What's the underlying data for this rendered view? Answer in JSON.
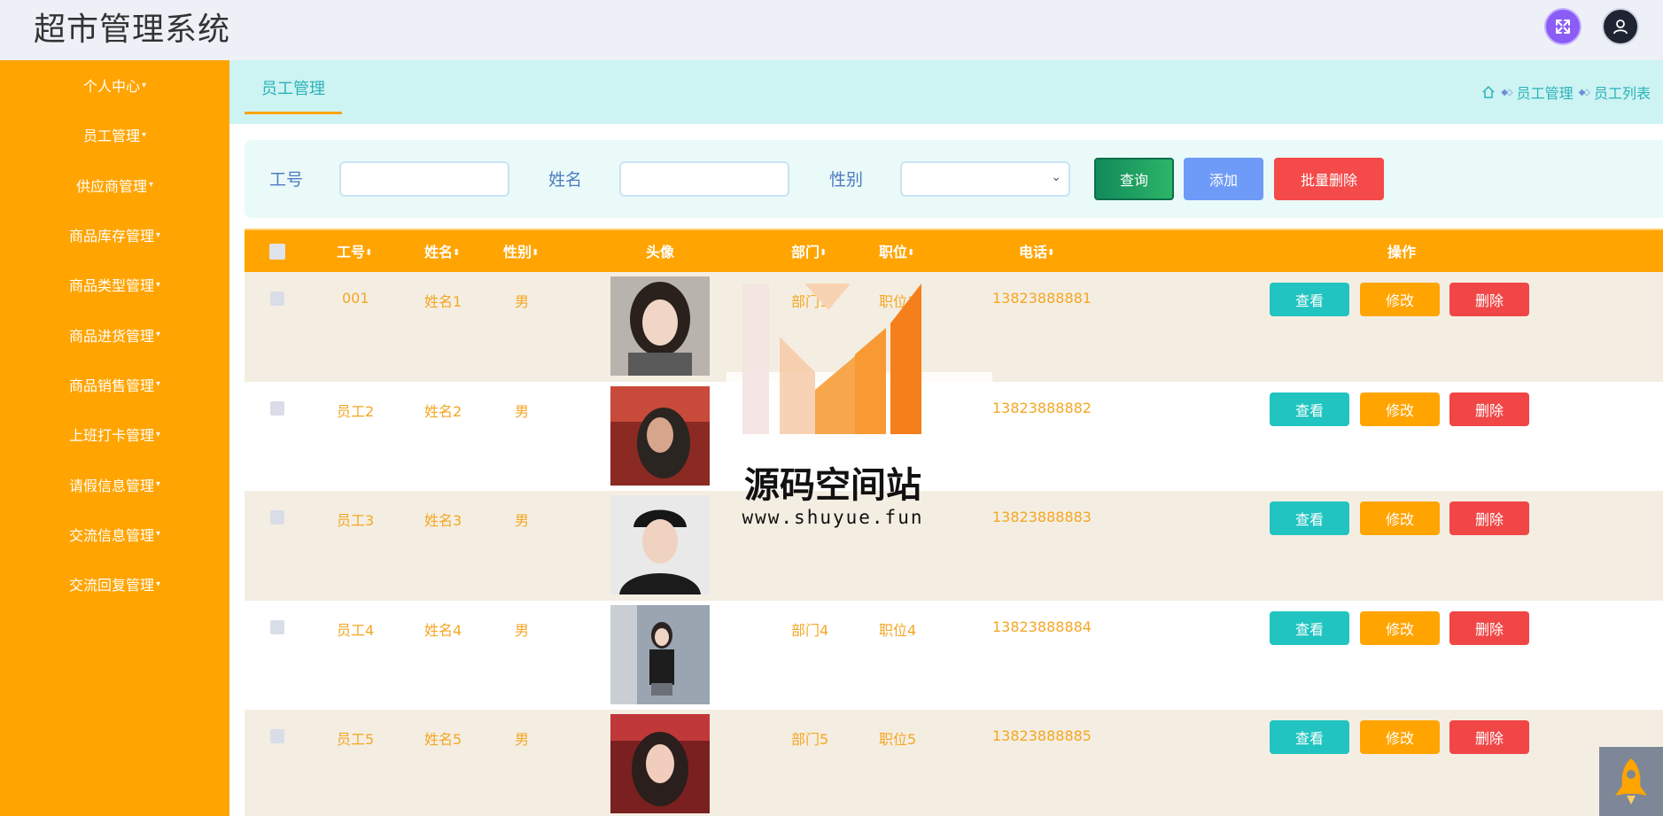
{
  "app": {
    "title": "超市管理系统"
  },
  "header": {
    "expand_icon": "expand-arrows-icon",
    "user_icon": "user-icon"
  },
  "sidebar": {
    "items": [
      {
        "label": "个人中心"
      },
      {
        "label": "员工管理"
      },
      {
        "label": "供应商管理"
      },
      {
        "label": "商品库存管理"
      },
      {
        "label": "商品类型管理"
      },
      {
        "label": "商品进货管理"
      },
      {
        "label": "商品销售管理"
      },
      {
        "label": "上班打卡管理"
      },
      {
        "label": "请假信息管理"
      },
      {
        "label": "交流信息管理"
      },
      {
        "label": "交流回复管理"
      }
    ]
  },
  "tabs": {
    "active": "员工管理"
  },
  "breadcrumb": {
    "items": [
      "员工管理",
      "员工列表"
    ]
  },
  "search": {
    "field1_label": "工号",
    "field1_value": "",
    "field2_label": "姓名",
    "field2_value": "",
    "field3_label": "性别",
    "field3_value": "",
    "query_label": "查询",
    "add_label": "添加",
    "batch_delete_label": "批量删除"
  },
  "table": {
    "columns": [
      "工号",
      "姓名",
      "性别",
      "头像",
      "部门",
      "职位",
      "电话",
      "操作"
    ],
    "action_labels": {
      "view": "查看",
      "edit": "修改",
      "delete": "删除"
    },
    "rows": [
      {
        "id": "001",
        "name": "姓名1",
        "gender": "男",
        "dept": "部门1",
        "position": "职位1",
        "phone": "13823888881"
      },
      {
        "id": "员工2",
        "name": "姓名2",
        "gender": "男",
        "dept": "",
        "position": "",
        "phone": "13823888882"
      },
      {
        "id": "员工3",
        "name": "姓名3",
        "gender": "男",
        "dept": "",
        "position": "",
        "phone": "13823888883"
      },
      {
        "id": "员工4",
        "name": "姓名4",
        "gender": "男",
        "dept": "部门4",
        "position": "职位4",
        "phone": "13823888884"
      },
      {
        "id": "员工5",
        "name": "姓名5",
        "gender": "男",
        "dept": "部门5",
        "position": "职位5",
        "phone": "13823888885"
      }
    ]
  },
  "watermark": {
    "title": "源码空间站",
    "url": "www.shuyue.fun"
  },
  "colors": {
    "sidebar": "#ffa400",
    "accent": "#2bb3b8",
    "view": "#21c4c0",
    "edit": "#ffa400",
    "delete": "#f04646"
  }
}
